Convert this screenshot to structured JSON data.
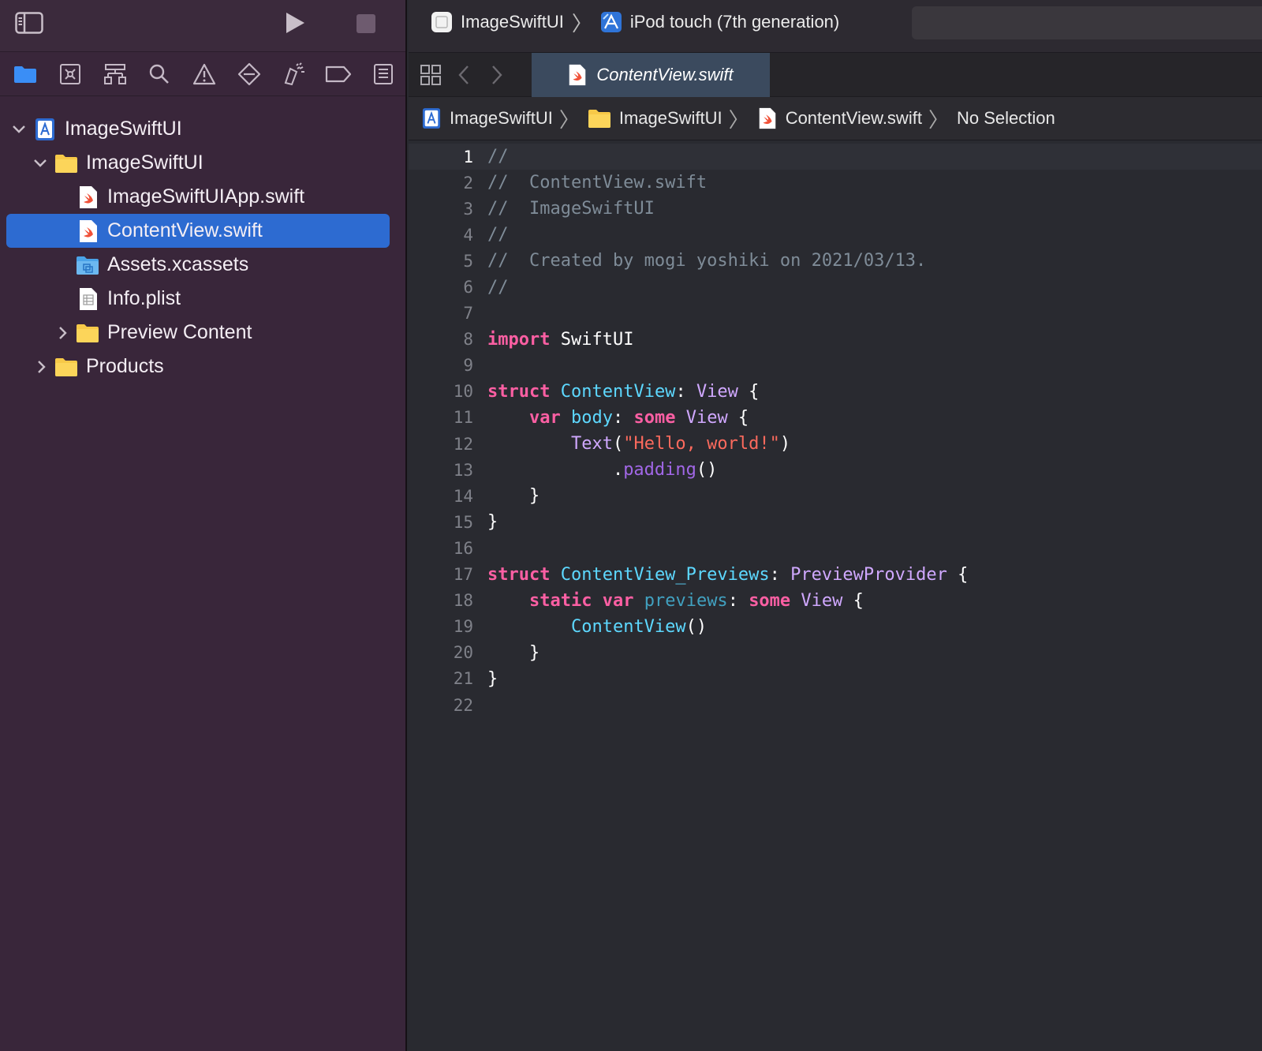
{
  "colors": {
    "sidebar_bg": "#39263a",
    "editor_bg": "#292a30",
    "selection": "#2d6bd1",
    "keyword": "#fc5fa3",
    "type_decl": "#5dd8ff",
    "system_type": "#d0a8ff",
    "string": "#fc6a5d",
    "comment": "#7f8c98"
  },
  "toolbar": {
    "sidebar_toggle_icon": "sidebar-icon",
    "run_icon": "play-icon",
    "stop_icon": "stop-icon"
  },
  "scheme": {
    "project": "ImageSwiftUI",
    "destination": "iPod touch (7th generation)"
  },
  "navigator_tabs": [
    "folder-icon",
    "source-control-icon",
    "symbol-icon",
    "search-icon",
    "warning-icon",
    "test-icon",
    "debug-icon",
    "breakpoint-icon",
    "report-icon"
  ],
  "tree": [
    {
      "label": "ImageSwiftUI",
      "icon": "project-icon",
      "disclosure": "open",
      "level": 0
    },
    {
      "label": "ImageSwiftUI",
      "icon": "folder-icon",
      "disclosure": "open",
      "level": 1
    },
    {
      "label": "ImageSwiftUIApp.swift",
      "icon": "swift-file-icon",
      "disclosure": "none",
      "level": 2
    },
    {
      "label": "ContentView.swift",
      "icon": "swift-file-icon",
      "disclosure": "none",
      "level": 2,
      "selected": true
    },
    {
      "label": "Assets.xcassets",
      "icon": "asset-catalog-icon",
      "disclosure": "none",
      "level": 2
    },
    {
      "label": "Info.plist",
      "icon": "plist-file-icon",
      "disclosure": "none",
      "level": 2
    },
    {
      "label": "Preview Content",
      "icon": "folder-icon",
      "disclosure": "closed",
      "level": 2
    },
    {
      "label": "Products",
      "icon": "folder-icon",
      "disclosure": "closed",
      "level": 1
    }
  ],
  "editor_tab": {
    "label": "ContentView.swift"
  },
  "jumpbar": {
    "items": [
      "ImageSwiftUI",
      "ImageSwiftUI",
      "ContentView.swift",
      "No Selection"
    ]
  },
  "code": {
    "current_line": 1,
    "lines": [
      {
        "n": "1",
        "tokens": [
          {
            "t": "//",
            "c": "comment"
          }
        ]
      },
      {
        "n": "2",
        "tokens": [
          {
            "t": "//  ContentView.swift",
            "c": "comment"
          }
        ]
      },
      {
        "n": "3",
        "tokens": [
          {
            "t": "//  ImageSwiftUI",
            "c": "comment"
          }
        ]
      },
      {
        "n": "4",
        "tokens": [
          {
            "t": "//",
            "c": "comment"
          }
        ]
      },
      {
        "n": "5",
        "tokens": [
          {
            "t": "//  Created by mogi yoshiki on 2021/03/13.",
            "c": "comment"
          }
        ]
      },
      {
        "n": "6",
        "tokens": [
          {
            "t": "//",
            "c": "comment"
          }
        ]
      },
      {
        "n": "7",
        "tokens": []
      },
      {
        "n": "8",
        "tokens": [
          {
            "t": "import",
            "c": "kw"
          },
          {
            "t": " SwiftUI",
            "c": "plain"
          }
        ]
      },
      {
        "n": "9",
        "tokens": []
      },
      {
        "n": "10",
        "tokens": [
          {
            "t": "struct",
            "c": "kw"
          },
          {
            "t": " ",
            "c": "plain"
          },
          {
            "t": "ContentView",
            "c": "type"
          },
          {
            "t": ": ",
            "c": "plain"
          },
          {
            "t": "View",
            "c": "sys"
          },
          {
            "t": " {",
            "c": "plain"
          }
        ]
      },
      {
        "n": "11",
        "tokens": [
          {
            "t": "    ",
            "c": "plain"
          },
          {
            "t": "var",
            "c": "kw"
          },
          {
            "t": " ",
            "c": "plain"
          },
          {
            "t": "body",
            "c": "type"
          },
          {
            "t": ": ",
            "c": "plain"
          },
          {
            "t": "some",
            "c": "kw"
          },
          {
            "t": " ",
            "c": "plain"
          },
          {
            "t": "View",
            "c": "sys"
          },
          {
            "t": " {",
            "c": "plain"
          }
        ]
      },
      {
        "n": "12",
        "tokens": [
          {
            "t": "        ",
            "c": "plain"
          },
          {
            "t": "Text",
            "c": "sys"
          },
          {
            "t": "(",
            "c": "plain"
          },
          {
            "t": "\"Hello, world!\"",
            "c": "str"
          },
          {
            "t": ")",
            "c": "plain"
          }
        ]
      },
      {
        "n": "13",
        "tokens": [
          {
            "t": "            .",
            "c": "plain"
          },
          {
            "t": "padding",
            "c": "sysm"
          },
          {
            "t": "()",
            "c": "plain"
          }
        ]
      },
      {
        "n": "14",
        "tokens": [
          {
            "t": "    }",
            "c": "plain"
          }
        ]
      },
      {
        "n": "15",
        "tokens": [
          {
            "t": "}",
            "c": "plain"
          }
        ]
      },
      {
        "n": "16",
        "tokens": []
      },
      {
        "n": "17",
        "tokens": [
          {
            "t": "struct",
            "c": "kw"
          },
          {
            "t": " ",
            "c": "plain"
          },
          {
            "t": "ContentView_Previews",
            "c": "type"
          },
          {
            "t": ": ",
            "c": "plain"
          },
          {
            "t": "PreviewProvider",
            "c": "sys"
          },
          {
            "t": " {",
            "c": "plain"
          }
        ]
      },
      {
        "n": "18",
        "tokens": [
          {
            "t": "    ",
            "c": "plain"
          },
          {
            "t": "static",
            "c": "kw"
          },
          {
            "t": " ",
            "c": "plain"
          },
          {
            "t": "var",
            "c": "kw"
          },
          {
            "t": " ",
            "c": "plain"
          },
          {
            "t": "previews",
            "c": "prop"
          },
          {
            "t": ": ",
            "c": "plain"
          },
          {
            "t": "some",
            "c": "kw"
          },
          {
            "t": " ",
            "c": "plain"
          },
          {
            "t": "View",
            "c": "sys"
          },
          {
            "t": " {",
            "c": "plain"
          }
        ]
      },
      {
        "n": "19",
        "tokens": [
          {
            "t": "        ",
            "c": "plain"
          },
          {
            "t": "ContentView",
            "c": "type"
          },
          {
            "t": "()",
            "c": "plain"
          }
        ]
      },
      {
        "n": "20",
        "tokens": [
          {
            "t": "    }",
            "c": "plain"
          }
        ]
      },
      {
        "n": "21",
        "tokens": [
          {
            "t": "}",
            "c": "plain"
          }
        ]
      },
      {
        "n": "22",
        "tokens": []
      }
    ]
  }
}
